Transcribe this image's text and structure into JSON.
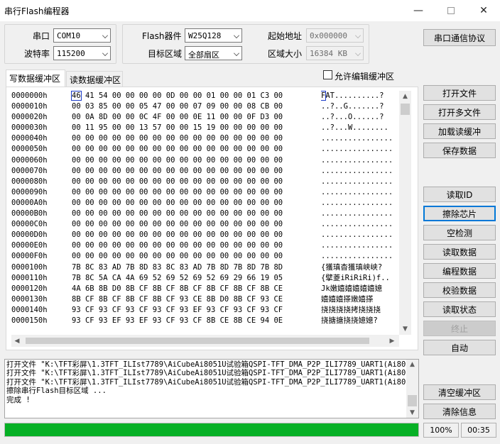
{
  "window": {
    "title": "串行Flash编程器",
    "minimize": "—",
    "close": "✕"
  },
  "port_group": {
    "port_label": "串口",
    "port_value": "COM10",
    "baud_label": "波特率",
    "baud_value": "115200"
  },
  "flash_group": {
    "device_label": "Flash器件",
    "device_value": "W25Q128",
    "target_label": "目标区域",
    "target_value": "全部扇区",
    "start_label": "起始地址",
    "start_value": "0x000000",
    "size_label": "区域大小",
    "size_value": "16384 KB"
  },
  "protocol_button": "串口通信协议",
  "tabs": [
    {
      "label": "写数据缓冲区",
      "active": true
    },
    {
      "label": "读数据缓冲区",
      "active": false
    }
  ],
  "allow_edit_label": "允许编辑缓冲区",
  "hex_rows": [
    {
      "addr": "0000000h",
      "bytes": "46 41 54 00 00 00 00 0D 00 00 01 00 00 01 C3 00",
      "ascii": "FAT..........?"
    },
    {
      "addr": "0000010h",
      "bytes": "00 03 85 00 00 05 47 00 00 07 09 00 00 08 CB 00",
      "ascii": "..?..G.......?"
    },
    {
      "addr": "0000020h",
      "bytes": "00 0A 8D 00 00 0C 4F 00 00 0E 11 00 00 0F D3 00",
      "ascii": "..?...O......?"
    },
    {
      "addr": "0000030h",
      "bytes": "00 11 95 00 00 13 57 00 00 15 19 00 00 00 00 00",
      "ascii": "..?...W........"
    },
    {
      "addr": "0000040h",
      "bytes": "00 00 00 00 00 00 00 00 00 00 00 00 00 00 00 00",
      "ascii": "................"
    },
    {
      "addr": "0000050h",
      "bytes": "00 00 00 00 00 00 00 00 00 00 00 00 00 00 00 00",
      "ascii": "................"
    },
    {
      "addr": "0000060h",
      "bytes": "00 00 00 00 00 00 00 00 00 00 00 00 00 00 00 00",
      "ascii": "................"
    },
    {
      "addr": "0000070h",
      "bytes": "00 00 00 00 00 00 00 00 00 00 00 00 00 00 00 00",
      "ascii": "................"
    },
    {
      "addr": "0000080h",
      "bytes": "00 00 00 00 00 00 00 00 00 00 00 00 00 00 00 00",
      "ascii": "................"
    },
    {
      "addr": "0000090h",
      "bytes": "00 00 00 00 00 00 00 00 00 00 00 00 00 00 00 00",
      "ascii": "................"
    },
    {
      "addr": "00000A0h",
      "bytes": "00 00 00 00 00 00 00 00 00 00 00 00 00 00 00 00",
      "ascii": "................"
    },
    {
      "addr": "00000B0h",
      "bytes": "00 00 00 00 00 00 00 00 00 00 00 00 00 00 00 00",
      "ascii": "................"
    },
    {
      "addr": "00000C0h",
      "bytes": "00 00 00 00 00 00 00 00 00 00 00 00 00 00 00 00",
      "ascii": "................"
    },
    {
      "addr": "00000D0h",
      "bytes": "00 00 00 00 00 00 00 00 00 00 00 00 00 00 00 00",
      "ascii": "................"
    },
    {
      "addr": "00000E0h",
      "bytes": "00 00 00 00 00 00 00 00 00 00 00 00 00 00 00 00",
      "ascii": "................"
    },
    {
      "addr": "00000F0h",
      "bytes": "00 00 00 00 00 00 00 00 00 00 00 00 00 00 00 00",
      "ascii": "................"
    },
    {
      "addr": "0000100h",
      "bytes": "7B 8C 83 AD 7B 8D 83 8C 83 AD 7B 8D 7B 8D 7B 8D",
      "ascii": "{獲瑱杳獲瑱峡峡?"
    },
    {
      "addr": "0000110h",
      "bytes": "7B 8C 5A CA 4A 69 52 69 52 69 52 69 29 66 19 05",
      "ascii": "{擘菱iRiRiRi)f.."
    },
    {
      "addr": "0000120h",
      "bytes": "4A 6B 8B D0 8B CF 8B CF 8B CF 8B CF 8B CF 8B CE",
      "ascii": "Jk嫩嬉嬉嬉嬉嬉嬑"
    },
    {
      "addr": "0000130h",
      "bytes": "8B CF 8B CF 8B CF 8B CF 93 CE 8B D0 8B CF 93 CE",
      "ascii": "嬉嬉嬉搽嫩嬉搽"
    },
    {
      "addr": "0000140h",
      "bytes": "93 CF 93 CF 93 CF 93 CF 93 EF 93 CF 93 CF 93 CF",
      "ascii": "挠挠挠挠拷挠挠挠"
    },
    {
      "addr": "0000150h",
      "bytes": "93 CF 93 EF 93 EF 93 CF 93 CF 8B CE 8B CE 94 0E",
      "ascii": "挠搪搪挠挠嬑嬑?"
    }
  ],
  "right_buttons": {
    "open_file": "打开文件",
    "open_multi": "打开多文件",
    "load_read": "加载读缓冲",
    "save_data": "保存数据",
    "read_id": "读取ID",
    "erase_chip": "擦除芯片",
    "blank_check": "空检测",
    "read_data": "读取数据",
    "program_data": "编程数据",
    "verify_data": "校验数据",
    "read_status": "读取状态",
    "stop": "终止",
    "auto": "自动",
    "clear_buffer": "清空缓冲区",
    "clear_info": "清除信息"
  },
  "log_text": "打开文件 \"K:\\TFT彩屏\\1.3TFT_ILIst7789\\AiCubeAi8051U试验箱QSPI-TFT_DMA_P2P_ILI7789_UART1(Ai8051\n打开文件 \"K:\\TFT彩屏\\1.3TFT_ILIst7789\\AiCubeAi8051U试验箱QSPI-TFT_DMA_P2P_ILI7789_UART1(Ai8051\n打开文件 \"K:\\TFT彩屏\\1.3TFT_ILIst7789\\AiCubeAi8051U试验箱QSPI-TFT_DMA_P2P_ILI7789_UART1(Ai8051\n擦除串行Flash目标区域 ...\n完成 !",
  "progress": {
    "fraction": 1.0,
    "percent_text": "100%",
    "time_text": "00:35"
  },
  "colors": {
    "progress": "#06b025",
    "focus": "#0078d7"
  }
}
